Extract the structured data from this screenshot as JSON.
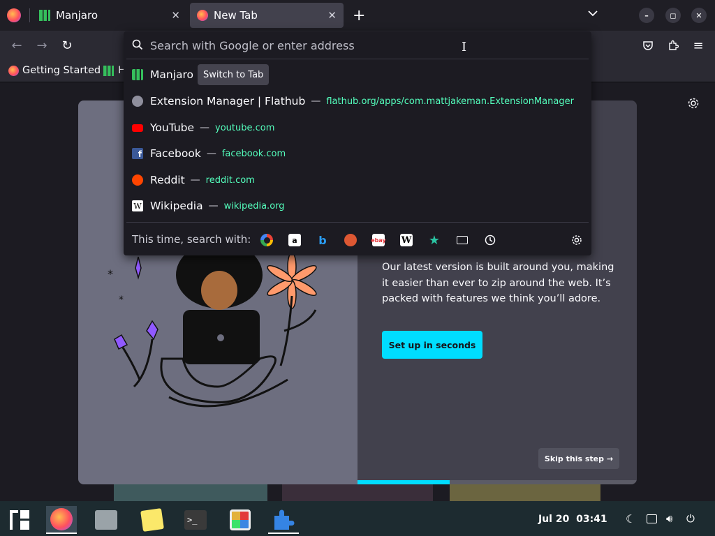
{
  "tabs": [
    {
      "label": "Manjaro"
    },
    {
      "label": "New Tab"
    }
  ],
  "bookmarks": [
    {
      "label": "Getting Started"
    },
    {
      "label": "H"
    }
  ],
  "urlbar": {
    "placeholder": "Search with Google or enter address"
  },
  "suggestions": [
    {
      "title": "Manjaro",
      "action": "Switch to Tab",
      "url": ""
    },
    {
      "title": "Extension Manager | Flathub",
      "url": "flathub.org/apps/com.mattjakeman.ExtensionManager"
    },
    {
      "title": "YouTube",
      "url": "youtube.com"
    },
    {
      "title": "Facebook",
      "url": "facebook.com"
    },
    {
      "title": "Reddit",
      "url": "reddit.com"
    },
    {
      "title": "Wikipedia",
      "url": "wikipedia.org"
    }
  ],
  "dash": "—",
  "search_with_label": "This time, search with:",
  "search_engines": [
    "google-icon",
    "amazon-icon",
    "bing-icon",
    "duckduckgo-icon",
    "ebay-icon",
    "wikipedia-icon",
    "bookmarks-star-icon",
    "tabs-icon",
    "history-icon"
  ],
  "onboarding": {
    "description": "Our latest version is built around you, making it easier than ever to zip around the web. It’s packed with features we think you’ll adore.",
    "cta": "Set up in seconds",
    "skip": "Skip this step →",
    "progress_fraction": 0.33
  },
  "taskbar": {
    "date": "Jul 20",
    "time": "03:41"
  },
  "colors": {
    "accent": "#00ddff",
    "url_green": "#54ffbd"
  }
}
